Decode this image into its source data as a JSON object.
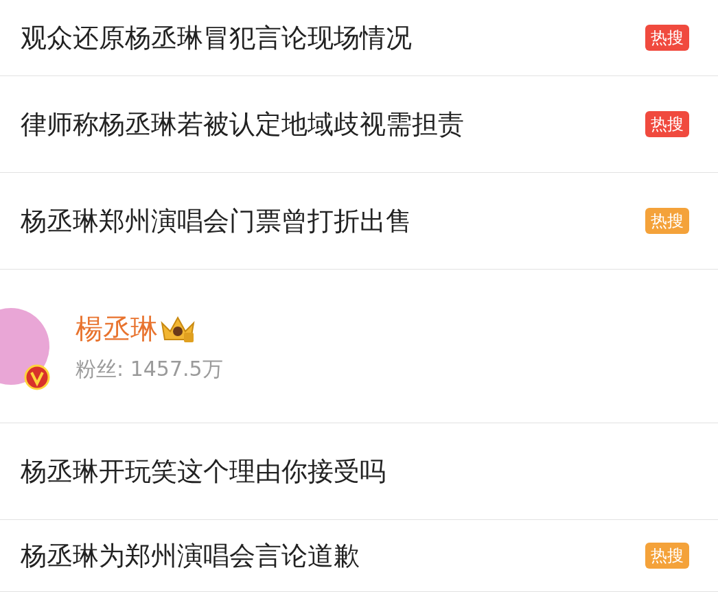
{
  "results": [
    {
      "kind": "topic",
      "title": "观众还原杨丞琳冒犯言论现场情况",
      "badge": "热搜",
      "color": "#f04a3e"
    },
    {
      "kind": "topic",
      "title": "律师称杨丞琳若被认定地域歧视需担责",
      "badge": "热搜",
      "color": "#f04a3e"
    },
    {
      "kind": "topic",
      "title": "杨丞琳郑州演唱会门票曾打折出售",
      "badge": "热搜",
      "color": "#f4a23a"
    },
    {
      "kind": "user",
      "name": "楊丞琳",
      "followers": "粉丝: 1457.5万"
    },
    {
      "kind": "topic",
      "title": "杨丞琳开玩笑这个理由你接受吗"
    },
    {
      "kind": "topic",
      "title": "杨丞琳为郑州演唱会言论道歉",
      "badge": "热搜",
      "color": "#f4a23a"
    }
  ]
}
